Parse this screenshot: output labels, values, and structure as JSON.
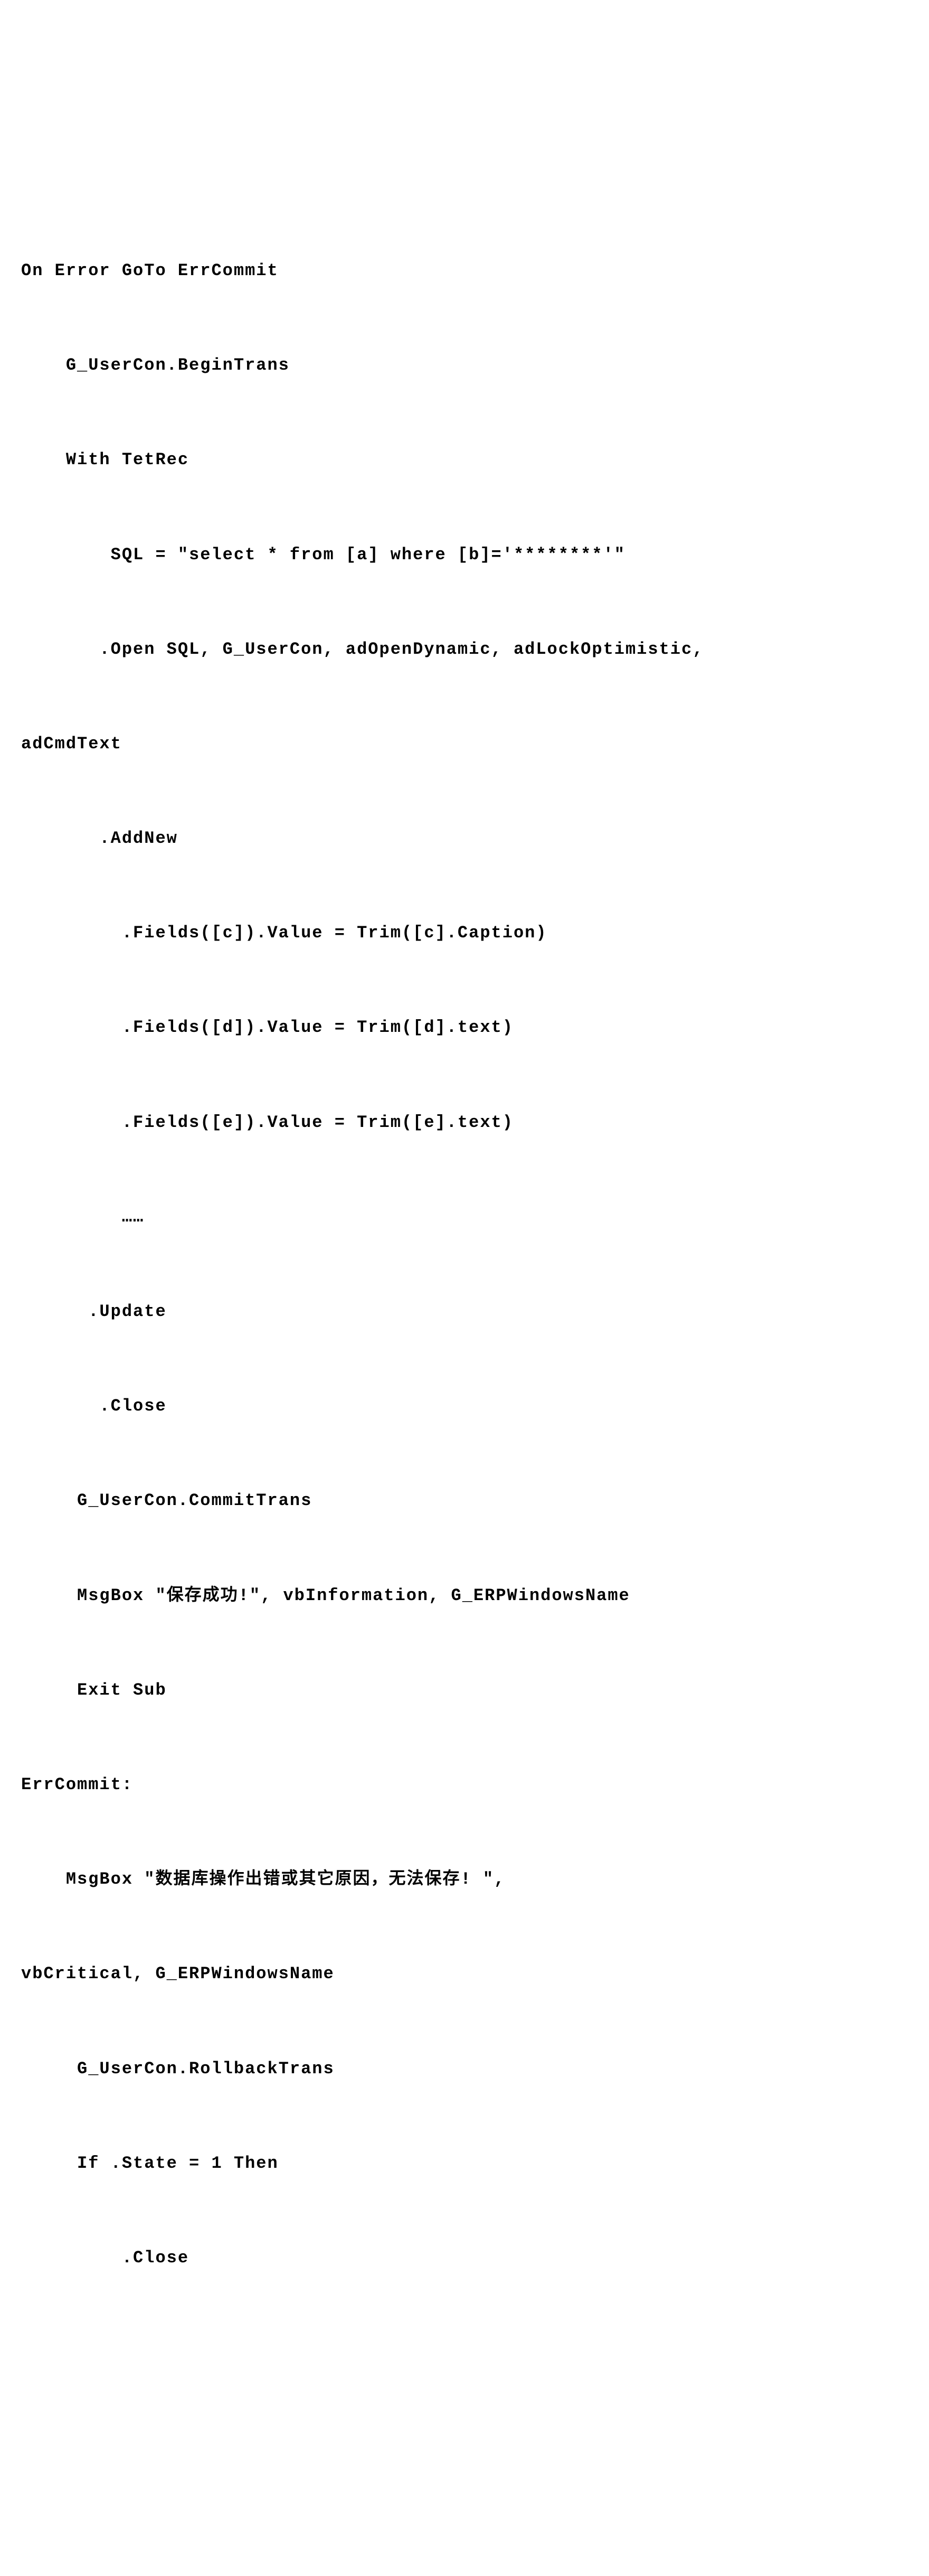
{
  "code": {
    "line1": "On Error GoTo ErrCommit",
    "line2": "    G_UserCon.BeginTrans",
    "line3": "    With TetRec",
    "line4": "        SQL = \"select * from [a] where [b]='********'\"",
    "line5": "       .Open SQL, G_UserCon, adOpenDynamic, adLockOptimistic,",
    "line6": "adCmdText",
    "line7": "       .AddNew",
    "line8": "         .Fields([c]).Value = Trim([c].Caption)",
    "line9": "         .Fields([d]).Value = Trim([d].text)",
    "line10": "         .Fields([e]).Value = Trim([e].text)",
    "line11": "         ……",
    "line12": "      .Update",
    "line13": "       .Close",
    "line14": "     G_UserCon.CommitTrans",
    "line15": "     MsgBox \"保存成功!\", vbInformation, G_ERPWindowsName",
    "line16": "     Exit Sub",
    "line17": "ErrCommit:",
    "line18": "    MsgBox \"数据库操作出错或其它原因，无法保存! \",",
    "line19": "vbCritical, G_ERPWindowsName",
    "line20": "     G_UserCon.RollbackTrans",
    "line21": "     If .State = 1 Then",
    "line22": "         .Close"
  }
}
